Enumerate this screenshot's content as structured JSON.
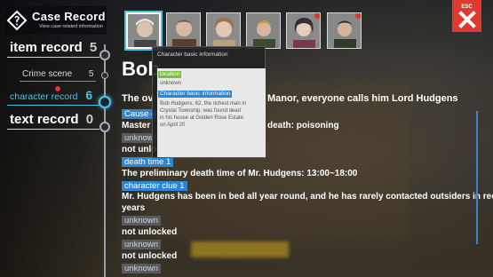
{
  "header": {
    "title": "Case Record",
    "subtitle": "View case related information"
  },
  "menu": {
    "item_record": {
      "label": "item record",
      "count": "5"
    },
    "crime_scene": {
      "label": "Crime scene",
      "count": "5"
    },
    "character_record": {
      "label": "character record",
      "count": "6"
    },
    "text_record": {
      "label": "text record",
      "count": "0"
    }
  },
  "portraits": [
    {
      "name": "portrait-1",
      "selected": true,
      "new": false
    },
    {
      "name": "portrait-2",
      "selected": false,
      "new": false
    },
    {
      "name": "portrait-3",
      "selected": false,
      "new": false
    },
    {
      "name": "portrait-4",
      "selected": false,
      "new": false
    },
    {
      "name": "portrait-5",
      "selected": false,
      "new": true
    },
    {
      "name": "portrait-6",
      "selected": false,
      "new": true
    }
  ],
  "esc": {
    "label": "ESC"
  },
  "character": {
    "name": "Bob",
    "intro_prefix": "The ov",
    "intro_suffix": "Manor, everyone calls him Lord Hudgens",
    "cause_tag": "Cause o",
    "master_prefix": "Master",
    "death_cause_suffix": "death: poisoning",
    "unknown_1": "unknow",
    "not_unlocked_1": "not unlo",
    "death_time_tag": "death time 1",
    "death_time_text": "The preliminary death time of Mr. Hudgens: 13:00~18:00",
    "clue_tag": "character clue 1",
    "clue_text_1": "Mr. Hudgens has been in bed all year round, and he has rarely contacted outsiders in recent",
    "clue_text_2": "years",
    "unknown_2": "unknown",
    "not_unlocked_2": "not unlocked",
    "unknown_3": "unknown",
    "not_unlocked_3": "not unlocked",
    "unknown_4": "unknown"
  },
  "tooltip": {
    "title": "Character basic information",
    "location_tag": "location",
    "location_value": "unknown",
    "basic_tag": "Character basic information",
    "basic_text_1": "Bob Hudgens, 62, the richest man in",
    "basic_text_2": "Crystal Township, was found dead",
    "basic_text_3": "in his house at Golden Rose Estate",
    "basic_text_4": "on April 20"
  },
  "colors": {
    "accent": "#4cc1ec",
    "tag_blue": "#2f86cf",
    "tag_gray": "#575a5e",
    "esc_red": "#e0392f",
    "tooltip_green": "#7cc242"
  }
}
